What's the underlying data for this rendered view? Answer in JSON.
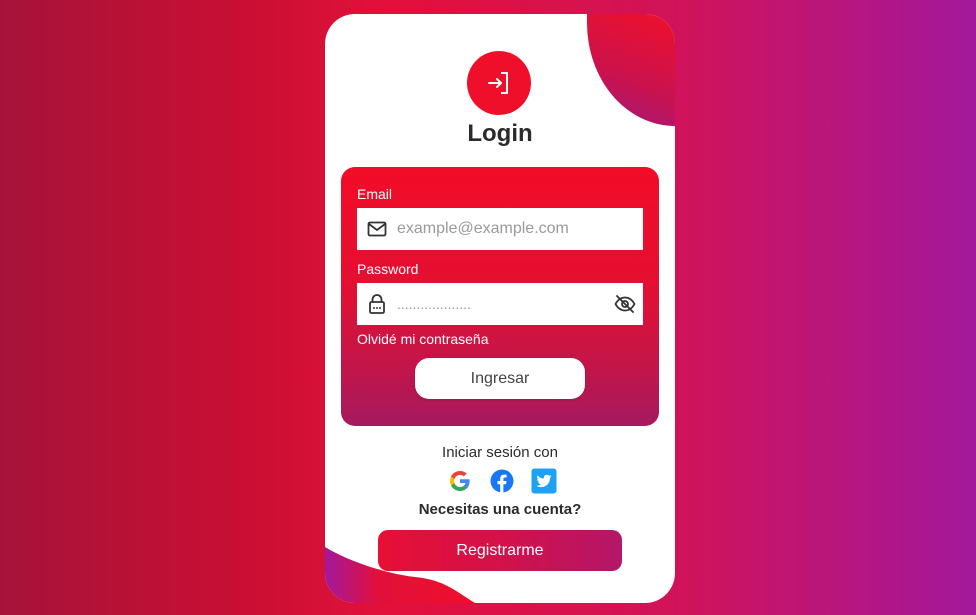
{
  "login": {
    "title": "Login",
    "email_label": "Email",
    "email_placeholder": "example@example.com",
    "email_icon": "mail-icon",
    "password_label": "Password",
    "password_mask": "...................",
    "password_icon": "lock-icon",
    "password_toggle_icon": "eye-off-icon",
    "forgot": "Olvidé mi contraseña",
    "submit": "Ingresar",
    "header_icon": "login-arrow-icon"
  },
  "social": {
    "title": "Iniciar sesión con",
    "providers": [
      "google-icon",
      "facebook-icon",
      "twitter-icon"
    ]
  },
  "register": {
    "question": "Necesitas una cuenta?",
    "button": "Registrarme"
  },
  "colors": {
    "accent": "#f00f2a",
    "accent_dark": "#a5195f",
    "purple": "#a3189c",
    "text": "#2b2b2b"
  }
}
